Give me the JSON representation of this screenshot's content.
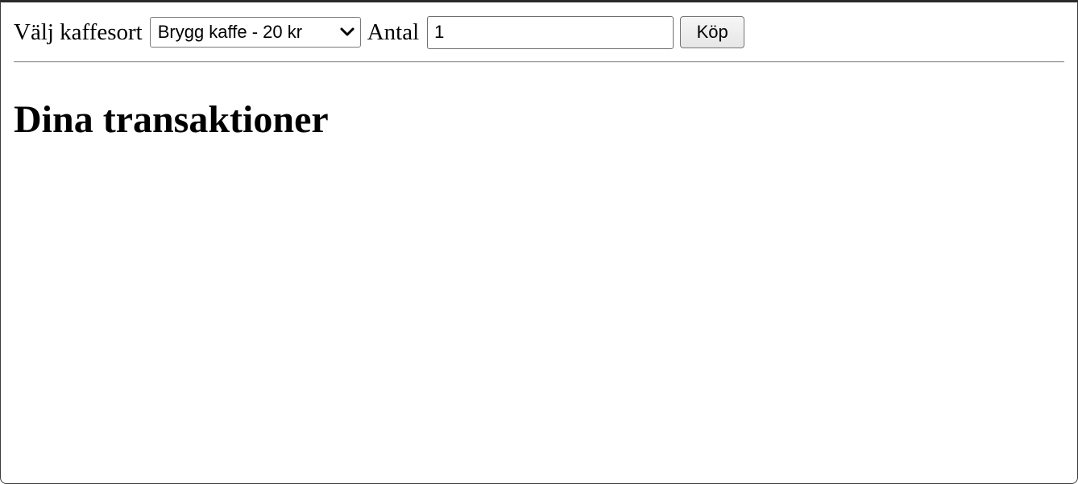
{
  "form": {
    "coffee_label": "Välj kaffesort",
    "coffee_select": {
      "selected": "Brygg kaffe - 20 kr"
    },
    "quantity_label": "Antal",
    "quantity_value": "1",
    "buy_label": "Köp"
  },
  "transactions": {
    "heading": "Dina transaktioner",
    "items": []
  },
  "icons": {
    "select_arrow": "chevron-down-icon"
  }
}
